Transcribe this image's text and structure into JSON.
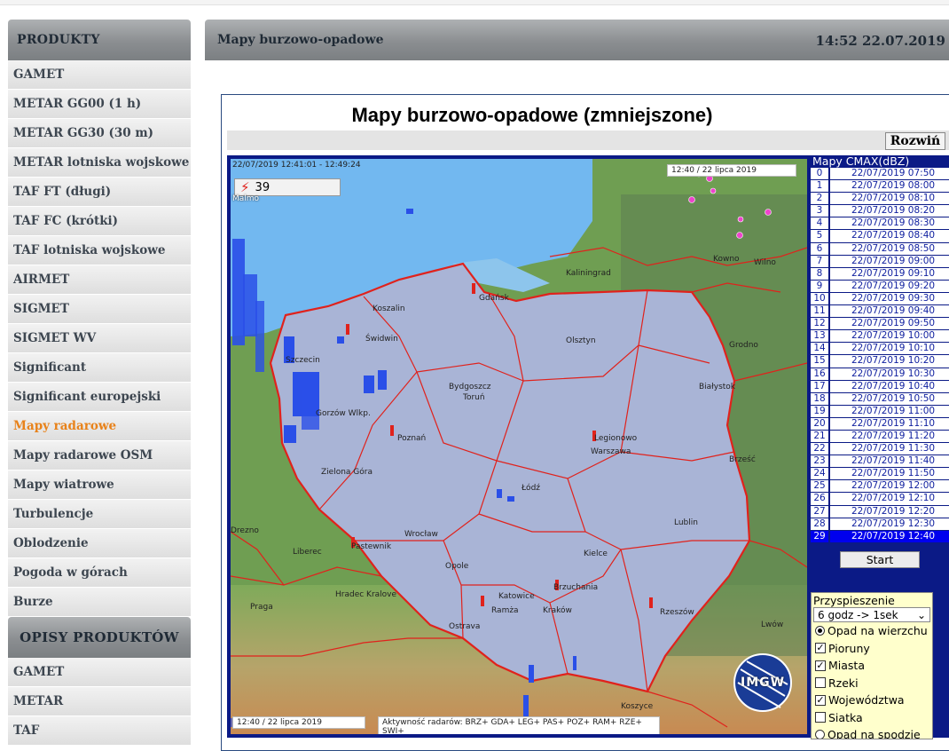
{
  "sidebar": {
    "header": "PRODUKTY",
    "items": [
      {
        "label": "GAMET"
      },
      {
        "label": "METAR GG00 (1 h)"
      },
      {
        "label": "METAR GG30 (30 m)"
      },
      {
        "label": "METAR lotniska wojskowe"
      },
      {
        "label": "TAF FT (długi)"
      },
      {
        "label": "TAF FC (krótki)"
      },
      {
        "label": "TAF lotniska wojskowe"
      },
      {
        "label": "AIRMET"
      },
      {
        "label": "SIGMET"
      },
      {
        "label": "SIGMET WV"
      },
      {
        "label": "Significant"
      },
      {
        "label": "Significant europejski"
      },
      {
        "label": "Mapy radarowe",
        "active": true
      },
      {
        "label": "Mapy radarowe OSM"
      },
      {
        "label": "Mapy wiatrowe"
      },
      {
        "label": "Turbulencje"
      },
      {
        "label": "Oblodzenie"
      },
      {
        "label": "Pogoda w górach"
      },
      {
        "label": "Burze"
      }
    ],
    "header2": "OPISY PRODUKTÓW",
    "items2": [
      {
        "label": "GAMET"
      },
      {
        "label": "METAR"
      },
      {
        "label": "TAF"
      }
    ]
  },
  "header": {
    "title": "Mapy burzowo-opadowe",
    "datetime": "14:52 22.07.2019"
  },
  "panel": {
    "title": "Mapy burzowo-opadowe (zmniejszone)",
    "expand_label": "Rozwiń"
  },
  "map": {
    "time_range": "22/07/2019 12:41:01 - 12:49:24",
    "top_stamp": "12:40 / 22 lipca 2019",
    "lightning_count": "39",
    "bottom_stamp": "12:40 / 22 lipca 2019",
    "radars": "Aktywność radarów: BRZ+ GDA+ LEG+ PAS+ POZ+ RAM+ RZE+ SWI+",
    "logo": "IMGW",
    "cities": [
      {
        "name": "Malmo",
        "color": "white"
      },
      {
        "name": "Koszalin"
      },
      {
        "name": "Gdańsk"
      },
      {
        "name": "Kaliningrad"
      },
      {
        "name": "Kowno"
      },
      {
        "name": "Wilno"
      },
      {
        "name": "Świdwin"
      },
      {
        "name": "Szczecin"
      },
      {
        "name": "Olsztyn"
      },
      {
        "name": "Grodno"
      },
      {
        "name": "Bydgoszcz"
      },
      {
        "name": "Toruń"
      },
      {
        "name": "Białystok"
      },
      {
        "name": "Gorzów Wlkp."
      },
      {
        "name": "Poznań"
      },
      {
        "name": "Legionowo"
      },
      {
        "name": "Warszawa"
      },
      {
        "name": "Brześć"
      },
      {
        "name": "Zielona Góra"
      },
      {
        "name": "Łódź"
      },
      {
        "name": "Lublin"
      },
      {
        "name": "Pastewnik"
      },
      {
        "name": "Wrocław"
      },
      {
        "name": "Liberec"
      },
      {
        "name": "Opole"
      },
      {
        "name": "Kielce"
      },
      {
        "name": "Brzuchania"
      },
      {
        "name": "Hradec Kralove"
      },
      {
        "name": "Katowice"
      },
      {
        "name": "Ramża"
      },
      {
        "name": "Kraków"
      },
      {
        "name": "Rzeszów"
      },
      {
        "name": "Praga"
      },
      {
        "name": "Ostrava"
      },
      {
        "name": "Lwów"
      },
      {
        "name": "Koszyce"
      },
      {
        "name": "Drezno"
      }
    ]
  },
  "timelist": {
    "header": "Mapy CMAX(dBZ)",
    "rows": [
      {
        "idx": "0",
        "time": "22/07/2019 07:50"
      },
      {
        "idx": "1",
        "time": "22/07/2019 08:00"
      },
      {
        "idx": "2",
        "time": "22/07/2019 08:10"
      },
      {
        "idx": "3",
        "time": "22/07/2019 08:20"
      },
      {
        "idx": "4",
        "time": "22/07/2019 08:30"
      },
      {
        "idx": "5",
        "time": "22/07/2019 08:40"
      },
      {
        "idx": "6",
        "time": "22/07/2019 08:50"
      },
      {
        "idx": "7",
        "time": "22/07/2019 09:00"
      },
      {
        "idx": "8",
        "time": "22/07/2019 09:10"
      },
      {
        "idx": "9",
        "time": "22/07/2019 09:20"
      },
      {
        "idx": "10",
        "time": "22/07/2019 09:30"
      },
      {
        "idx": "11",
        "time": "22/07/2019 09:40"
      },
      {
        "idx": "12",
        "time": "22/07/2019 09:50"
      },
      {
        "idx": "13",
        "time": "22/07/2019 10:00"
      },
      {
        "idx": "14",
        "time": "22/07/2019 10:10"
      },
      {
        "idx": "15",
        "time": "22/07/2019 10:20"
      },
      {
        "idx": "16",
        "time": "22/07/2019 10:30"
      },
      {
        "idx": "17",
        "time": "22/07/2019 10:40"
      },
      {
        "idx": "18",
        "time": "22/07/2019 10:50"
      },
      {
        "idx": "19",
        "time": "22/07/2019 11:00"
      },
      {
        "idx": "20",
        "time": "22/07/2019 11:10"
      },
      {
        "idx": "21",
        "time": "22/07/2019 11:20"
      },
      {
        "idx": "22",
        "time": "22/07/2019 11:30"
      },
      {
        "idx": "23",
        "time": "22/07/2019 11:40"
      },
      {
        "idx": "24",
        "time": "22/07/2019 11:50"
      },
      {
        "idx": "25",
        "time": "22/07/2019 12:00"
      },
      {
        "idx": "26",
        "time": "22/07/2019 12:10"
      },
      {
        "idx": "27",
        "time": "22/07/2019 12:20"
      },
      {
        "idx": "28",
        "time": "22/07/2019 12:30"
      },
      {
        "idx": "29",
        "time": "22/07/2019 12:40",
        "selected": true
      }
    ],
    "start_label": "Start"
  },
  "options": {
    "speed_label": "Przyspieszenie",
    "speed_value": "6 godz -> 1sek",
    "items": [
      {
        "type": "radio",
        "checked": true,
        "label": "Opad na wierzchu"
      },
      {
        "type": "checkbox",
        "checked": true,
        "label": "Pioruny"
      },
      {
        "type": "checkbox",
        "checked": true,
        "label": "Miasta"
      },
      {
        "type": "checkbox",
        "checked": false,
        "label": "Rzeki"
      },
      {
        "type": "checkbox",
        "checked": true,
        "label": "Województwa"
      },
      {
        "type": "checkbox",
        "checked": false,
        "label": "Siatka"
      },
      {
        "type": "radio",
        "checked": false,
        "label": "Opad na spodzie"
      }
    ]
  },
  "colors": {
    "accent_active": "#e8821a",
    "map_frame": "#0b1a86",
    "selected_row": "#0000ee",
    "poland_fill": "#a9b4d6",
    "border_red": "#e0221c",
    "sea": "#72b8f0"
  }
}
